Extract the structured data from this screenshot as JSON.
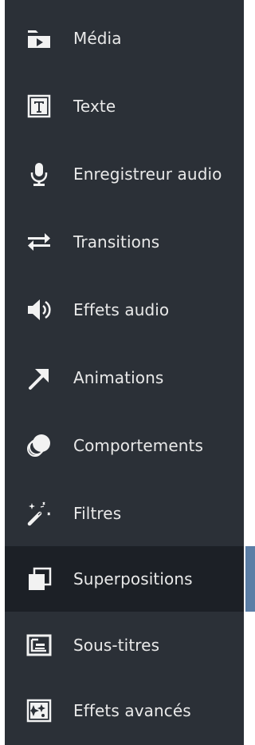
{
  "sidebar": {
    "items": [
      {
        "label": "Média",
        "icon": "media-folder-icon"
      },
      {
        "label": "Texte",
        "icon": "text-box-icon"
      },
      {
        "label": "Enregistreur audio",
        "icon": "microphone-icon"
      },
      {
        "label": "Transitions",
        "icon": "transition-arrows-icon"
      },
      {
        "label": "Effets audio",
        "icon": "speaker-icon"
      },
      {
        "label": "Animations",
        "icon": "arrow-icon"
      },
      {
        "label": "Comportements",
        "icon": "behavior-circles-icon"
      },
      {
        "label": "Filtres",
        "icon": "magic-wand-icon"
      },
      {
        "label": "Superpositions",
        "icon": "overlay-squares-icon",
        "active": true
      },
      {
        "label": "Sous-titres",
        "icon": "subtitles-icon"
      },
      {
        "label": "Effets avancés",
        "icon": "advanced-effects-icon"
      }
    ]
  },
  "colors": {
    "panel": "#2b3037",
    "active": "#1c2026",
    "accent": "#5b7ea6",
    "text": "#e9e9e9"
  }
}
